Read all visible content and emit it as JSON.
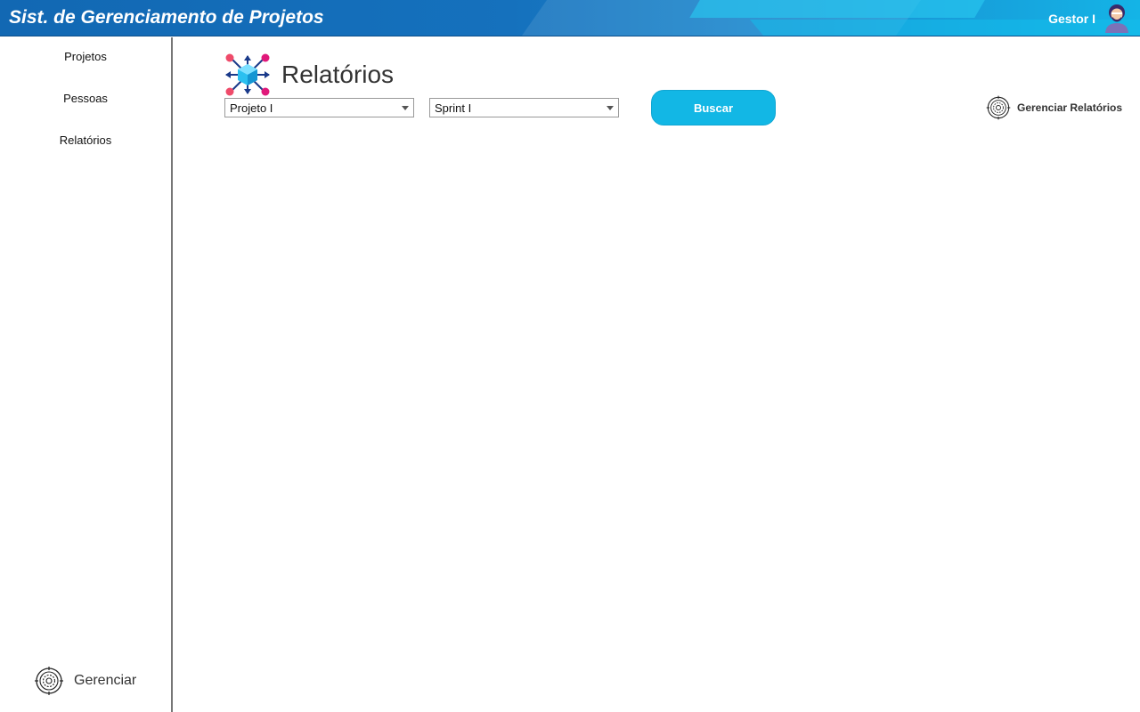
{
  "header": {
    "app_title": "Sist. de Gerenciamento de Projetos",
    "user_name": "Gestor I",
    "avatar_icon": "user-avatar-icon"
  },
  "sidebar": {
    "items": [
      {
        "label": "Projetos"
      },
      {
        "label": "Pessoas"
      },
      {
        "label": "Relatórios"
      }
    ],
    "manage": {
      "label": "Gerenciar",
      "icon": "target-gear-icon"
    }
  },
  "main": {
    "title": "Relatórios",
    "title_icon": "network-cube-icon",
    "filters": {
      "project_value": "Projeto I",
      "sprint_value": "Sprint I"
    },
    "search_label": "Buscar",
    "manage_reports_label": "Gerenciar Relatórios"
  },
  "colors": {
    "accent": "#12b7e5",
    "header_blue": "#1268b3"
  }
}
